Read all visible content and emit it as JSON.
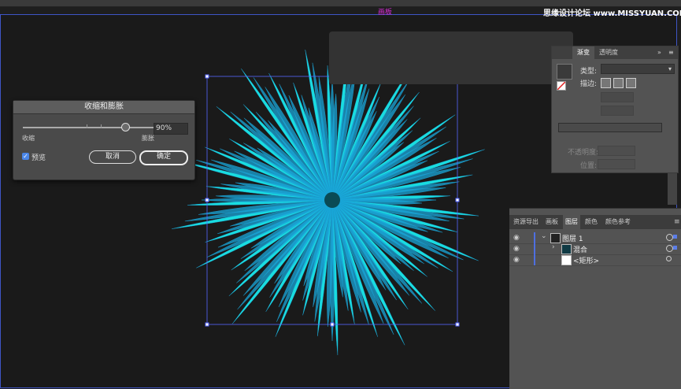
{
  "app": {
    "artboard_label": "画板",
    "watermark": "思缘设计论坛 www.MISSYUAN.COM"
  },
  "dialog": {
    "title": "收缩和膨胀",
    "slider_value_percent": 90,
    "slider_value": "90%",
    "label_shrink": "收缩",
    "label_bloat": "膨胀",
    "preview_label": "预览",
    "preview_checked": true,
    "preview_check_glyph": "✓",
    "cancel_label": "取消",
    "ok_label": "确定"
  },
  "gradient_panel": {
    "tab_gradient": "渐变",
    "tab_transparency": "透明度",
    "collapse_glyph": "»",
    "menu_glyph": "≡",
    "type_label": "类型:",
    "type_value": "▾",
    "stroke_label": "描边:",
    "opacity_label": "不透明度:",
    "position_label": "位置:"
  },
  "layers_panel": {
    "tabs": [
      "资源导出",
      "画板",
      "图层",
      "颜色",
      "颜色参考"
    ],
    "menu_glyph": "≡",
    "rows": [
      {
        "expand": "⌄",
        "name": "图层 1"
      },
      {
        "expand": "›",
        "name": "混合"
      },
      {
        "expand": "",
        "name": "<矩形>"
      }
    ],
    "eye_glyph": "◉"
  },
  "colors": {
    "accent_cyan": "#19e8ea",
    "petal_blue": "#1aa5d8",
    "selection_blue": "#3e55c6",
    "artboard_label": "#d62bd6"
  }
}
